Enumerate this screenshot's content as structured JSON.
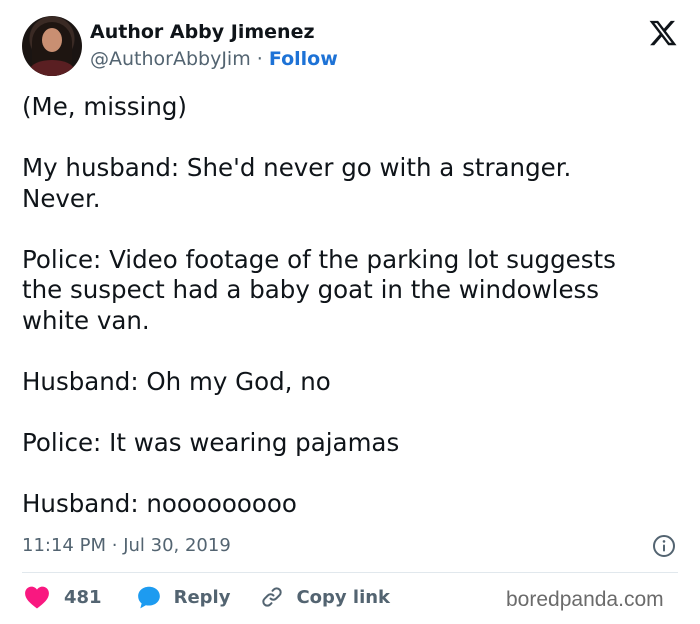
{
  "author": {
    "display_name": "Author Abby Jimenez",
    "handle": "@AuthorAbbyJim",
    "separator": "·",
    "follow_label": "Follow"
  },
  "tweet": {
    "lines": [
      "(Me, missing)",
      "",
      "My husband: She'd never go with a stranger.",
      "Never.",
      "",
      "Police: Video footage of the parking lot suggests",
      "the suspect had a baby goat in the windowless",
      "white van.",
      "",
      "Husband: Oh my God, no",
      "",
      "Police: It was wearing pajamas",
      "",
      "Husband: nooooooooo"
    ]
  },
  "meta": {
    "time": "11:14 PM",
    "separator": "·",
    "date": "Jul 30, 2019"
  },
  "actions": {
    "like_count": "481",
    "reply_label": "Reply",
    "copy_label": "Copy link"
  },
  "watermark": "boredpanda.com",
  "colors": {
    "like": "#f91880",
    "reply": "#1d9bf0",
    "follow": "#1d72d6",
    "muted": "#536471"
  },
  "icons": [
    "x-logo-icon",
    "info-icon",
    "heart-icon",
    "reply-bubble-icon",
    "link-icon"
  ]
}
